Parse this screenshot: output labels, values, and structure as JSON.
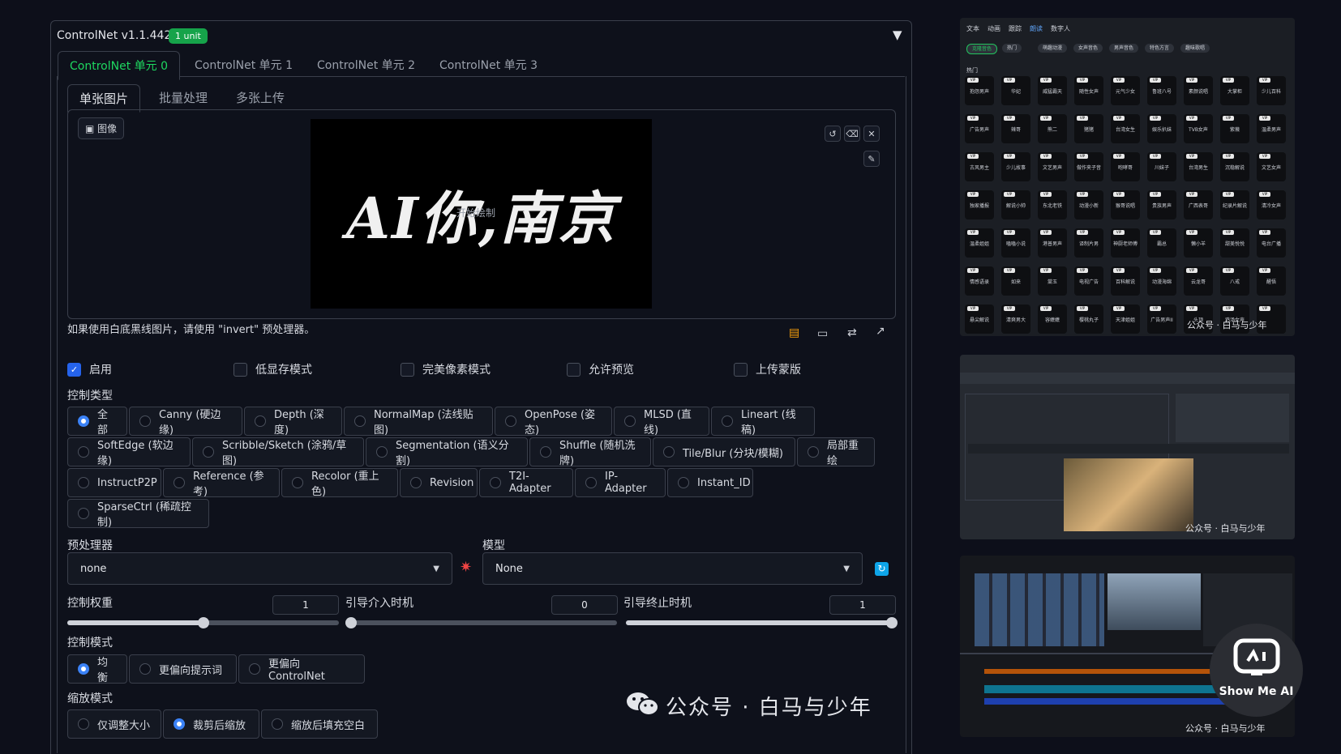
{
  "panel": {
    "title": "ControlNet v1.1.442",
    "badge": "1 unit",
    "collapse_icon": "▼"
  },
  "unit_tabs": [
    "ControlNet 单元 0",
    "ControlNet 单元 1",
    "ControlNet 单元 2",
    "ControlNet 单元 3"
  ],
  "sub_tabs": [
    "单张图片",
    "批量处理",
    "多张上传"
  ],
  "image": {
    "label": "图像",
    "canvas_text": "AI你,南京",
    "overlay_text": "开始绘制"
  },
  "hint": "如果使用白底黑线图片，请使用 \"invert\" 预处理器。",
  "options": {
    "enable": "启用",
    "low_vram": "低显存模式",
    "pixel_perfect": "完美像素模式",
    "allow_preview": "允许预览",
    "upload_mask": "上传蒙版"
  },
  "control_type": {
    "label": "控制类型",
    "items": [
      "全部",
      "Canny (硬边缘)",
      "Depth (深度)",
      "NormalMap (法线贴图)",
      "OpenPose (姿态)",
      "MLSD (直线)",
      "Lineart (线稿)",
      "SoftEdge (软边缘)",
      "Scribble/Sketch (涂鸦/草图)",
      "Segmentation (语义分割)",
      "Shuffle (随机洗牌)",
      "Tile/Blur (分块/模糊)",
      "局部重绘",
      "InstructP2P",
      "Reference (参考)",
      "Recolor (重上色)",
      "Revision",
      "T2I-Adapter",
      "IP-Adapter",
      "Instant_ID",
      "SparseCtrl (稀疏控制)"
    ],
    "selected": "全部"
  },
  "preprocessor": {
    "label": "预处理器",
    "value": "none"
  },
  "model": {
    "label": "模型",
    "value": "None"
  },
  "weights": {
    "control_weight_label": "控制权重",
    "control_weight": "1",
    "control_weight_fraction": 0.5,
    "start_label": "引导介入时机",
    "start": "0",
    "start_fraction": 0.0,
    "end_label": "引导终止时机",
    "end": "1",
    "end_fraction": 1.0
  },
  "control_mode": {
    "label": "控制模式",
    "items": [
      "均衡",
      "更偏向提示词",
      "更偏向 ControlNet"
    ],
    "selected": "均衡"
  },
  "resize_mode": {
    "label": "缩放模式",
    "items": [
      "仅调整大小",
      "裁剪后缩放",
      "缩放后填充空白"
    ],
    "selected": "裁剪后缩放"
  },
  "watermark": "公众号 · 白马与少年",
  "thumbs": {
    "t1_nav": [
      "文本",
      "动画",
      "跟踪",
      "朗读",
      "数字人"
    ],
    "t1_pills": [
      "克隆音色",
      "热门",
      "萌趣动漫",
      "女声音色",
      "男声音色",
      "特色方言",
      "趣味歌唱"
    ],
    "t1_section": "热门",
    "t1_voices": [
      "抱怨男声",
      "华妃",
      "威猛霸天",
      "随性女声",
      "元气少女",
      "鲁班八号",
      "素颜说唱",
      "大掌柜",
      "少儿百科",
      "广告男声",
      "辣哥",
      "熊二",
      "猪猪",
      "台湾女生",
      "娱乐扒妹",
      "TVB女声",
      "紫薇",
      "温柔男声",
      "古风男主",
      "少儿故事",
      "文艺男声",
      "做作夹子音",
      "咆哮哥",
      "川妹子",
      "台湾男生",
      "沉稳解说",
      "文艺女声",
      "独家播报",
      "解说小帅",
      "东北老铁",
      "动漫小新",
      "猴哥说唱",
      "贵族男声",
      "广西表哥",
      "纪录片解说",
      "清冷女声",
      "温柔姐姐",
      "嗑嗑小说",
      "港普男声",
      "译制片男",
      "神厨老师傅",
      "霸总",
      "懒小羊",
      "甜美悦悦",
      "电台广播",
      "情感语录",
      "如来",
      "棠玉",
      "电视广告",
      "百科解说",
      "动漫海绵",
      "云龙哥",
      "八戒",
      "醒悟",
      "悬尖解说",
      "清爽男大",
      "容嬷嬷",
      "樱桃丸子",
      "天津姐姐",
      "广告男声II",
      "头顶",
      "鸡汤女声",
      ""
    ],
    "wm": "公众号 · 白马与少年",
    "logo_text": "Show Me AI"
  }
}
